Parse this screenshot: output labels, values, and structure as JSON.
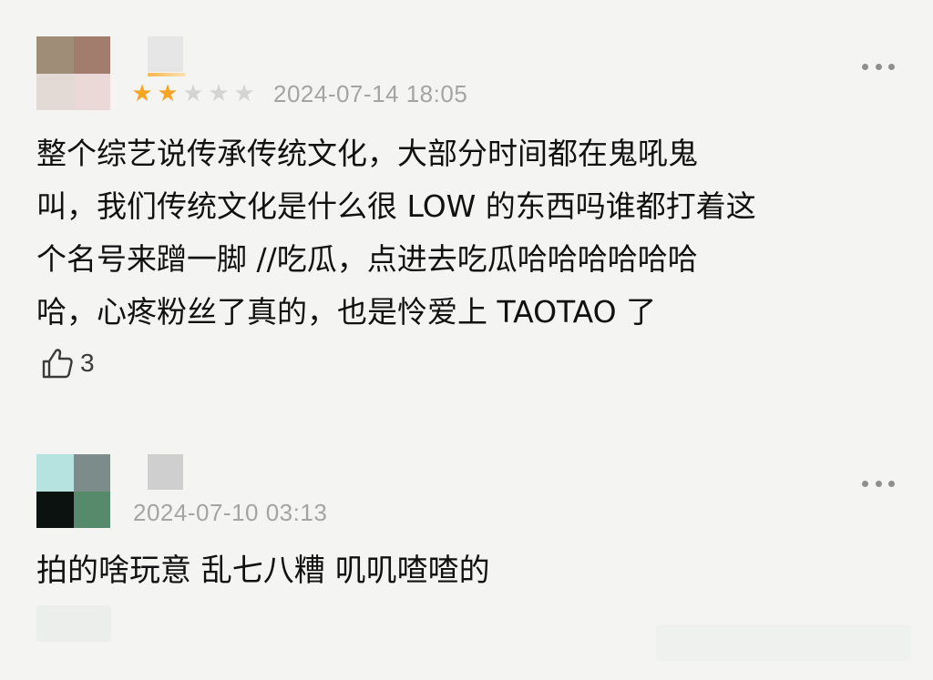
{
  "comments": [
    {
      "rating": {
        "filled": 2,
        "total": 5
      },
      "timestamp": "2024-07-14 18:05",
      "lines": [
        "整个综艺说传承传统文化，大部分时间都在鬼吼鬼",
        "叫，我们传统文化是什么很 LOW 的东西吗谁都打着这",
        "个名号来蹭一脚 //吃瓜，点进去吃瓜哈哈哈哈哈哈",
        "哈，心疼粉丝了真的，也是怜爱上 TAOTAO 了"
      ],
      "likes": "3",
      "avatar_colors": [
        "#a08d77",
        "#a27c6c",
        "#e3dad6",
        "#ead9d6"
      ],
      "username_color": "#e6e6e6",
      "more_icon": "ellipsis-icon",
      "like_icon": "thumbs-up-icon",
      "star_icon": "star-icon"
    },
    {
      "timestamp": "2024-07-10 03:13",
      "lines": [
        "拍的啥玩意 乱七八糟 叽叽喳喳的"
      ],
      "avatar_colors": [
        "#b6e3df",
        "#7b8c8b",
        "#0c1210",
        "#578a6a"
      ],
      "username_color": "#cfcfcf",
      "more_icon": "ellipsis-icon"
    }
  ],
  "colors": {
    "background": "#f4f5f3",
    "star_filled": "#f3a523",
    "star_empty": "#d4d4d4",
    "timestamp": "#a4a4a4",
    "text": "#111111"
  }
}
